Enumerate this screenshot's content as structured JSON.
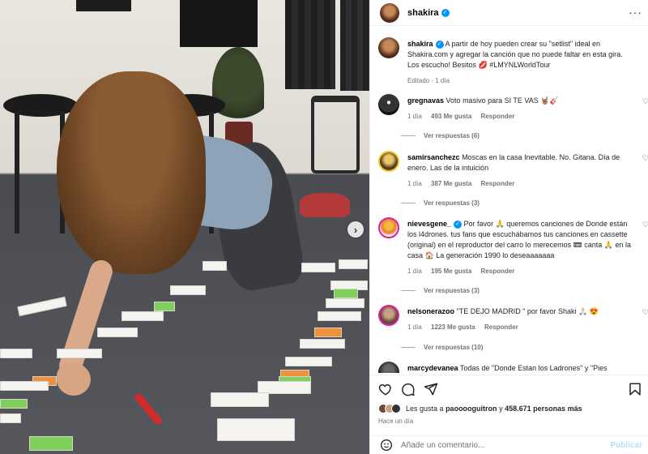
{
  "post": {
    "author": "shakira",
    "more_icon": "more-horizontal-icon",
    "caption": "A partir de hoy pueden crear su \"setlist\" ideal en Shakira.com y agregar la canción que no puede faltar en esta gira. Los escucho! Besitos 💋 #LMYNLWorldTour",
    "caption_meta": "Editado · 1 día"
  },
  "comments": [
    {
      "user": "gregnavas",
      "text": "Voto masivo para SI TE VAS 🤘🏽🎸",
      "time": "1 día",
      "likes": "493 Me gusta",
      "reply": "Responder",
      "replies": "Ver respuestas (6)"
    },
    {
      "user": "samirsanchezc",
      "text": "Moscas en la casa Inevitable. No. Gitana. Día de enero. Las de la intuición",
      "time": "1 día",
      "likes": "387 Me gusta",
      "reply": "Responder",
      "replies": "Ver respuestas (3)"
    },
    {
      "user": "nievesgene_",
      "text": "Por favor 🙏 queremos canciones de Donde están los l4drones. tus fans que escuchábamos tus canciones en cassette (original) en el reproductor del carro lo merecemos 📼 canta 🙏 en la casa 🏠 La generación 1990 lo deseaaaaaaa",
      "time": "1 día",
      "likes": "195 Me gusta",
      "reply": "Responder",
      "replies": "Ver respuestas (3)"
    },
    {
      "user": "nelsonerazoo",
      "text": "\"TE DEJO MADRID \" por favor Shaki 🙏🏻 😍",
      "time": "1 día",
      "likes": "1223 Me gusta",
      "reply": "Responder",
      "replies": "Ver respuestas (10)"
    },
    {
      "user": "marcydevanea",
      "text": "Todas de \"Donde Estan los Ladrones\" y \"Pies",
      "time": "",
      "likes": "",
      "reply": "",
      "replies": ""
    }
  ],
  "likes_summary": {
    "prefix": "Les gusta a",
    "user": "paooooguitron",
    "conj": "y",
    "count": "458.671 personas más"
  },
  "time_ago": "Hace un día",
  "add_comment": {
    "placeholder": "Añade un comentario...",
    "publish": "Publicar"
  },
  "colors": {
    "verified": "#0095f6",
    "publish": "#b2dffc",
    "meta": "#737373"
  }
}
